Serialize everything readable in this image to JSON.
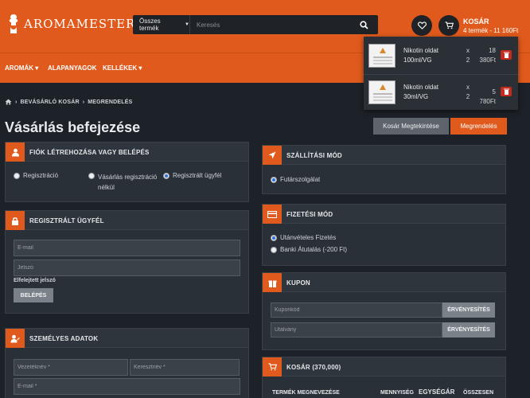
{
  "brand": {
    "name": "AROMAMESTER"
  },
  "search": {
    "category": "Összes termék",
    "placeholder": "Keresés"
  },
  "cart_summary": {
    "title": "KOSÁR",
    "info": "4 termék - 11 160Ft"
  },
  "nav": {
    "items": [
      "AROMÁK",
      "ALAPANYAGOK",
      "KELLÉKEK"
    ]
  },
  "cart_dropdown": {
    "items": [
      {
        "name": "Nikotin oldat 100ml/VG",
        "x": "x",
        "qty": "2",
        "unit_size": "18",
        "price": "380Ft"
      },
      {
        "name": "Nikotin oldat 30ml/VG",
        "x": "x",
        "qty": "2",
        "price": "5 780Ft"
      }
    ]
  },
  "breadcrumb": {
    "items": [
      "BEVÁSÁRLÓ KOSÁR",
      "MEGRENDELÉS"
    ]
  },
  "page_title": "Vásárlás befejezése",
  "actions": {
    "view_cart": "Kosár Megtekintése",
    "order": "Megrendelés"
  },
  "account_panel": {
    "title": "FIÓK LÉTREHOZÁSA VAGY BELÉPÉS",
    "options": [
      "Regisztráció",
      "Vásárlás regisztráció nélkül",
      "Regisztrált ügyfél"
    ]
  },
  "login_panel": {
    "title": "REGISZTRÁLT ÜGYFÉL",
    "email_placeholder": "E-mail",
    "password_placeholder": "Jelszó",
    "forgot": "Elfelejtett jelszó",
    "login_button": "BELÉPÉS"
  },
  "personal_panel": {
    "title": "SZEMÉLYES ADATOK",
    "lastname_placeholder": "Vezetéknév *",
    "firstname_placeholder": "Keresztnév *",
    "email_placeholder": "E-mail *"
  },
  "shipping_panel": {
    "title": "SZÁLLÍTÁSI MÓD",
    "options": [
      "Futárszolgálat"
    ]
  },
  "payment_panel": {
    "title": "FIZETÉSI MÓD",
    "options": [
      "Utánvételes Fizetés",
      "Banki Átutalás (-200 Ft)"
    ]
  },
  "coupon_panel": {
    "title": "KUPON",
    "coupon_placeholder": "Kuponkód",
    "voucher_placeholder": "Utalvány",
    "apply_label": "ÉRVÉNYESÍTÉS"
  },
  "cart_panel": {
    "title": "KOSÁR (370,000)",
    "columns": [
      "TERMÉK MEGNEVEZÉSE",
      "MENNYISÉG",
      "EGYSÉGÁR",
      "ÖSSZESEN"
    ]
  },
  "colors": {
    "accent": "#e05a1d",
    "background": "#1d2228",
    "panel": "#2a3037",
    "danger": "#c62b20"
  }
}
